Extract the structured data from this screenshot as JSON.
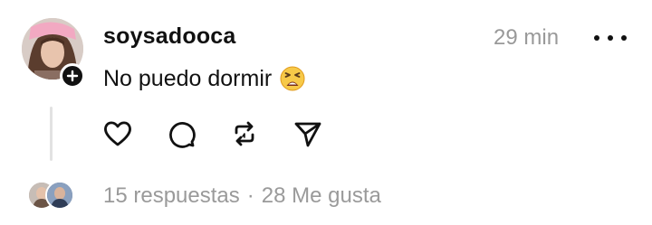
{
  "post": {
    "username": "soysadooca",
    "timestamp": "29 min",
    "text": "No puedo dormir",
    "emoji": "tired-face-emoji",
    "icons": {
      "like": "heart-icon",
      "reply": "comment-icon",
      "repost": "repost-icon",
      "share": "send-icon",
      "more": "more-options-icon",
      "follow": "plus-icon"
    }
  },
  "stats": {
    "replies": "15 respuestas",
    "separator": "·",
    "likes": "28 Me gusta"
  }
}
